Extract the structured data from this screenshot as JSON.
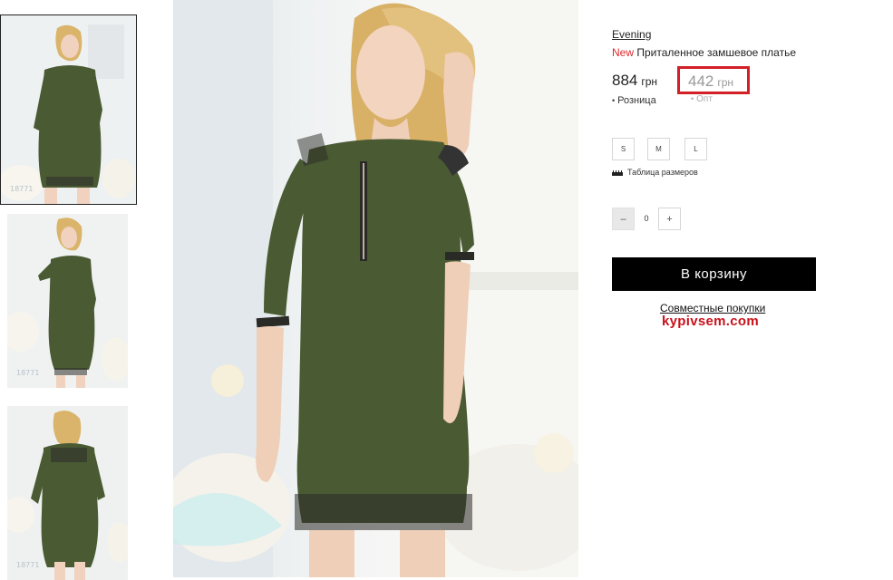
{
  "gallery": {
    "thumbnails": [
      {
        "code": "18771",
        "view": "front",
        "active": true
      },
      {
        "code": "18771",
        "view": "side",
        "active": false
      },
      {
        "code": "18771",
        "view": "back",
        "active": false
      }
    ]
  },
  "product": {
    "brand": "Evening",
    "badge": "New",
    "title": "Приталенное замшевое платье",
    "retail_price": "884",
    "opt_price": "442",
    "currency": "грн",
    "retail_label": "Розница",
    "opt_label": "Опт",
    "sizes": [
      "S",
      "M",
      "L"
    ],
    "size_chart_label": "Таблица размеров",
    "quantity": "0",
    "qty_minus": "–",
    "qty_plus": "+",
    "cart_button": "В корзину",
    "joint_purchase_link": "Совместные покупки",
    "site_logo": "kypivsem.com"
  },
  "colors": {
    "dress": "#4a5a33",
    "accent_red": "#d32027",
    "cart_bg": "#000000"
  }
}
